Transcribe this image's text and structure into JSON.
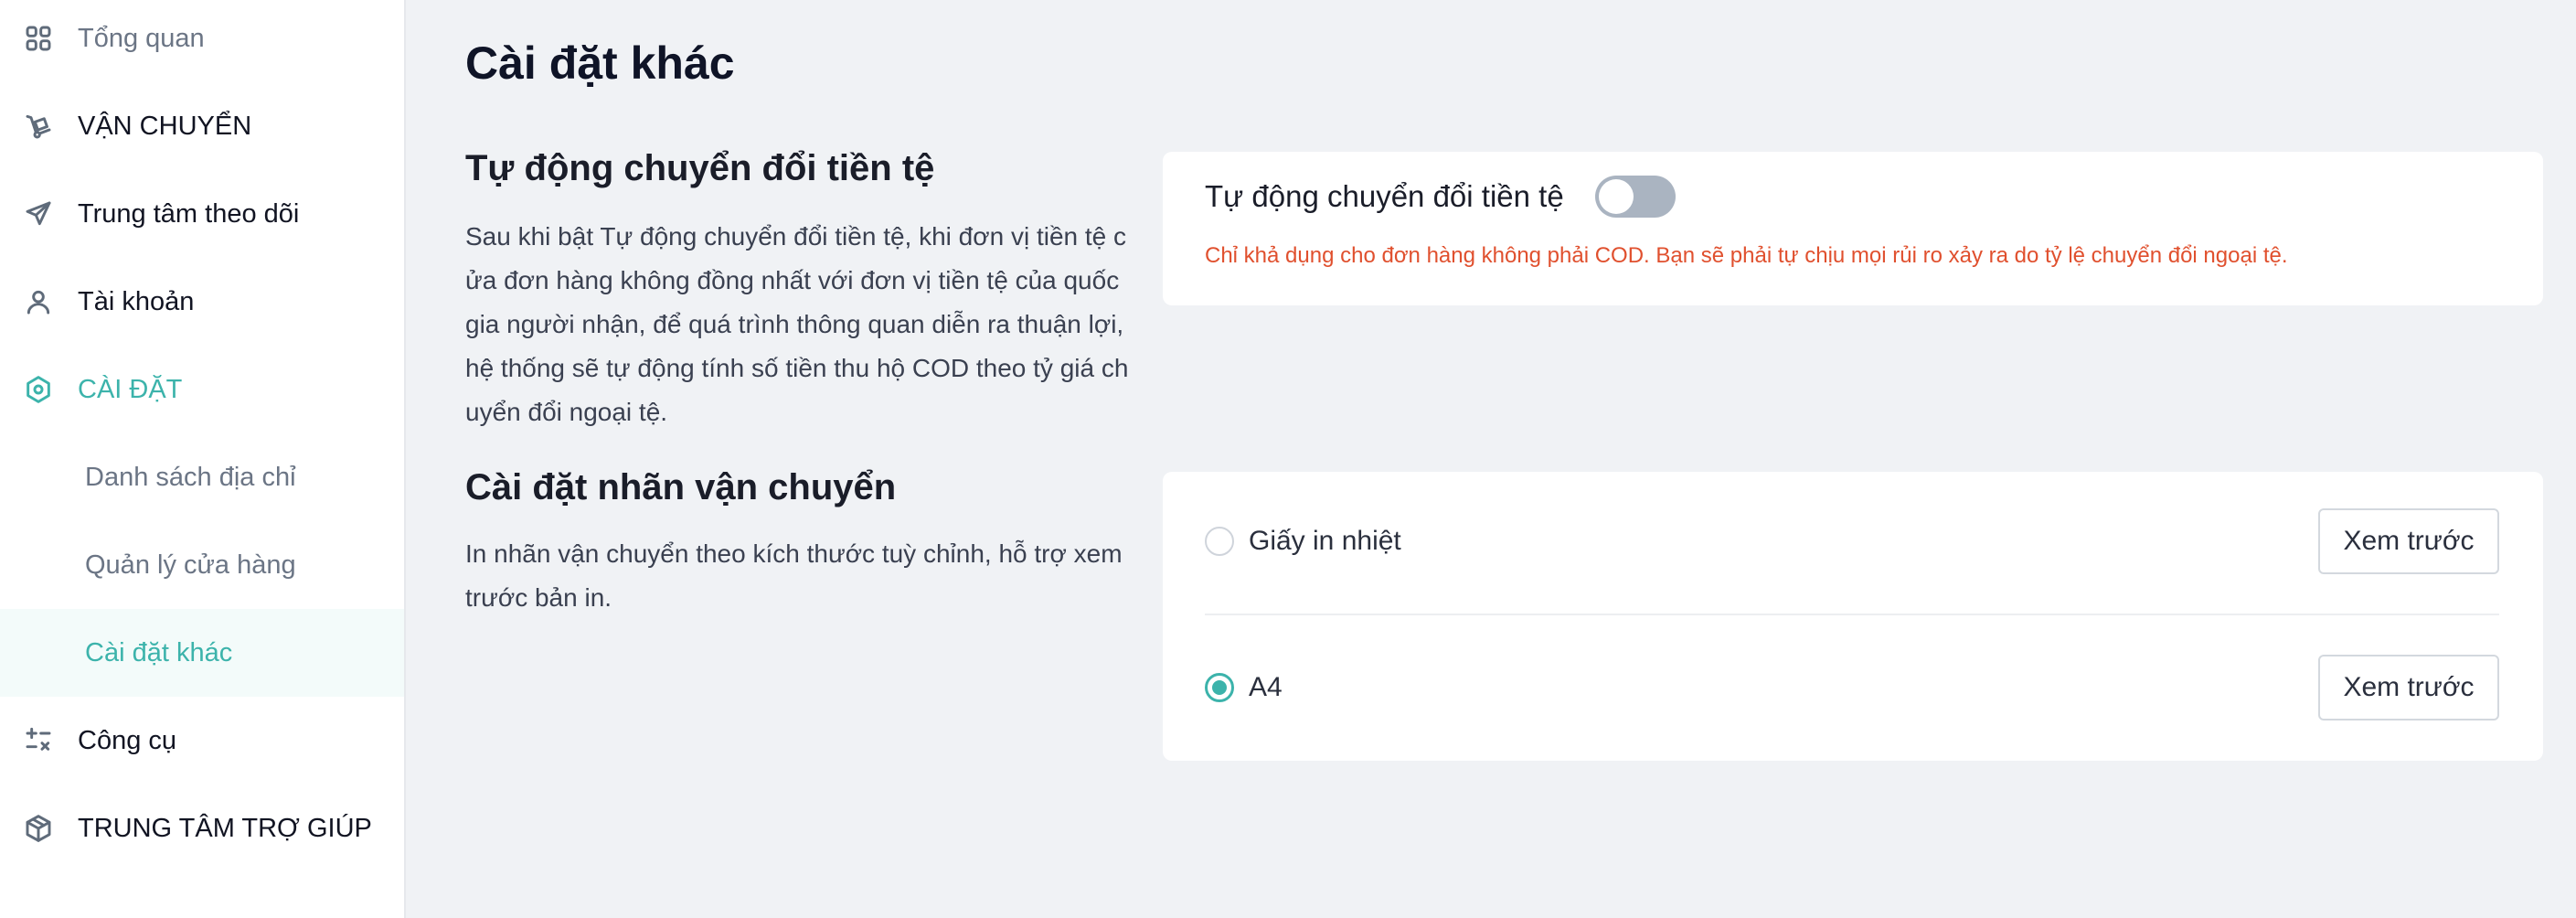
{
  "sidebar": {
    "items": [
      {
        "label": "Tổng quan",
        "icon": "dashboard-icon"
      },
      {
        "label": "VẬN CHUYỂN",
        "icon": "dolly-icon"
      },
      {
        "label": "Trung tâm theo dõi",
        "icon": "send-icon"
      },
      {
        "label": "Tài khoản",
        "icon": "user-icon"
      },
      {
        "label": "CÀI ĐẶT",
        "icon": "settings-hex-icon"
      },
      {
        "label": "Danh sách địa chỉ"
      },
      {
        "label": "Quản lý cửa hàng"
      },
      {
        "label": "Cài đặt khác"
      },
      {
        "label": "Công cụ",
        "icon": "calculator-icon"
      },
      {
        "label": "TRUNG TÂM TRỢ GIÚP",
        "icon": "box-icon"
      }
    ]
  },
  "main": {
    "title": "Cài đặt khác",
    "currency": {
      "title": "Tự động chuyển đổi tiền tệ",
      "description": "Sau khi bật Tự động chuyển đổi tiền tệ, khi đơn vị tiền tệ cửa đơn hàng không đồng nhất với đơn vị tiền tệ của quốc gia người nhận, để quá trình thông quan diễn ra thuận lợi, hệ thống sẽ tự động tính số tiền thu hộ COD theo tỷ giá chuyển đổi ngoại tệ.",
      "toggle_label": "Tự động chuyển đổi tiền tệ",
      "toggle_on": false,
      "warning": "Chỉ khả dụng cho đơn hàng không phải COD. Bạn sẽ phải tự chịu mọi rủi ro xảy ra do tỷ lệ chuyển đổi ngoại tệ."
    },
    "label_settings": {
      "title": "Cài đặt nhãn vận chuyển",
      "description": "In nhãn vận chuyển theo kích thước tuỳ chỉnh, hỗ trợ xem trước bản in.",
      "options": [
        {
          "label": "Giấy in nhiệt",
          "selected": false,
          "button": "Xem trước"
        },
        {
          "label": "A4",
          "selected": true,
          "button": "Xem trước"
        }
      ]
    }
  },
  "colors": {
    "accent": "#3cb3ab",
    "warning": "#e0502e",
    "background": "#f0f2f5",
    "toggle_off": "#aab4c1"
  }
}
